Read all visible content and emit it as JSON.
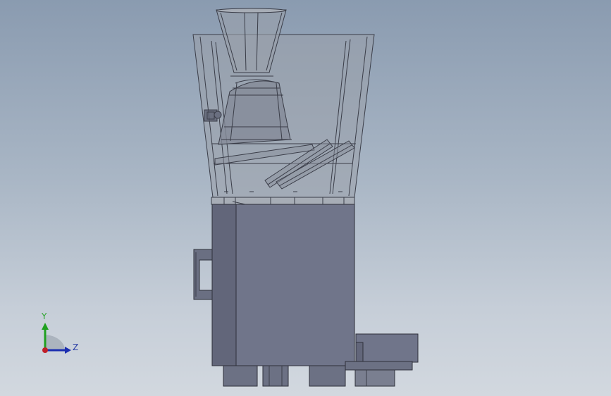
{
  "viewport": {
    "background_top": "#8a9bb0",
    "background_bottom": "#d2d8df"
  },
  "model": {
    "edge_color": "#3a3d48",
    "body_color": "#70758a",
    "body_side_color": "#62667a",
    "hopper_fill": "#9aa0aa"
  },
  "triad": {
    "y_label": "Y",
    "z_label": "Z",
    "y_color": "#1fa01f",
    "z_color": "#1c2fb0",
    "origin_color": "#c0202a"
  }
}
